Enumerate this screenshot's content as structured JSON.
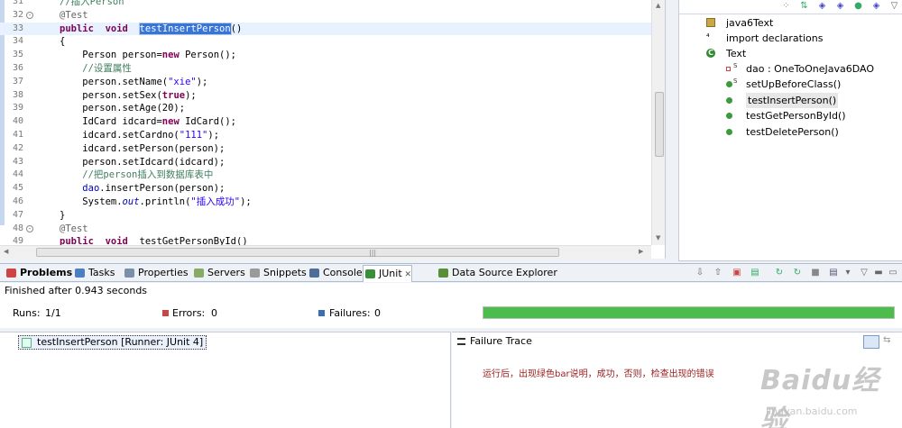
{
  "editor": {
    "lines": [
      {
        "n": "31",
        "text": "//插入Person",
        "type": "comment"
      },
      {
        "n": "32",
        "text": "@Test",
        "type": "annotation",
        "fold": true
      },
      {
        "n": "33",
        "type": "sig",
        "kw1": "public",
        "kw2": "void",
        "method": "testInsertPerson",
        "rest": "()"
      },
      {
        "n": "34",
        "text": "{",
        "type": "plain"
      },
      {
        "n": "35",
        "text": "    Person person=new Person();",
        "type": "plain"
      },
      {
        "n": "36",
        "text": "    //设置属性",
        "type": "comment"
      },
      {
        "n": "37",
        "text": "    person.setName(\"xie\");",
        "type": "plain"
      },
      {
        "n": "38",
        "text": "    person.setSex(true);",
        "type": "plain"
      },
      {
        "n": "39",
        "text": "    person.setAge(20);",
        "type": "plain"
      },
      {
        "n": "40",
        "text": "    IdCard idcard=new IdCard();",
        "type": "plain"
      },
      {
        "n": "41",
        "text": "    idcard.setCardno(\"111\");",
        "type": "plain"
      },
      {
        "n": "42",
        "text": "    idcard.setPerson(person);",
        "type": "plain"
      },
      {
        "n": "43",
        "text": "    person.setIdcard(idcard);",
        "type": "plain"
      },
      {
        "n": "44",
        "text": "    //把person插入到数据库表中",
        "type": "comment"
      },
      {
        "n": "45",
        "text": "    dao.insertPerson(person);",
        "type": "plain"
      },
      {
        "n": "46",
        "text": "    System.out.println(\"插入成功\");",
        "type": "plain"
      },
      {
        "n": "47",
        "text": "}",
        "type": "plain"
      },
      {
        "n": "48",
        "text": "@Test",
        "type": "annotation",
        "fold": true
      },
      {
        "n": "49",
        "text": "public  void  testGetPersonById()",
        "type": "plain"
      }
    ]
  },
  "outline": {
    "items": [
      {
        "label": "java6Text",
        "icon": "package-icon",
        "indent": 0
      },
      {
        "label": "import declarations",
        "icon": "import-icon",
        "indent": 0
      },
      {
        "label": "Text",
        "icon": "class-icon",
        "indent": 0
      },
      {
        "label": "dao : OneToOneJava6DAO",
        "icon": "private-field-icon",
        "indent": 1,
        "static": true
      },
      {
        "label": "setUpBeforeClass()",
        "icon": "public-method-icon",
        "indent": 1,
        "static": true
      },
      {
        "label": "testInsertPerson()",
        "icon": "public-method-icon",
        "indent": 1,
        "selected": true
      },
      {
        "label": "testGetPersonById()",
        "icon": "public-method-icon",
        "indent": 1
      },
      {
        "label": "testDeletePerson()",
        "icon": "public-method-icon",
        "indent": 1
      }
    ]
  },
  "tabs": [
    {
      "label": "Problems",
      "icon": "problems-icon",
      "color": "#c44",
      "active": false
    },
    {
      "label": "Tasks",
      "icon": "tasks-icon",
      "color": "#4a7fc1",
      "active": false
    },
    {
      "label": "Properties",
      "icon": "properties-icon",
      "color": "#7d8fa8",
      "active": false
    },
    {
      "label": "Servers",
      "icon": "servers-icon",
      "color": "#8a6",
      "active": false
    },
    {
      "label": "Snippets",
      "icon": "snippets-icon",
      "color": "#9a9a9a",
      "active": false
    },
    {
      "label": "Console",
      "icon": "console-icon",
      "color": "#4e6e9a",
      "active": false
    },
    {
      "label": "JUnit",
      "icon": "junit-icon",
      "color": "#3a8f3a",
      "active": true
    },
    {
      "label": "Data Source Explorer",
      "icon": "data-source-icon",
      "color": "#5a8f3a",
      "active": false
    }
  ],
  "junit": {
    "status": "Finished after 0.943 seconds",
    "runs_label": "Runs:",
    "runs_value": "1/1",
    "errors_label": "Errors:",
    "errors_value": "0",
    "failures_label": "Failures:",
    "failures_value": "0",
    "progress": 1.0,
    "bar_color": "#4cbd4c",
    "tree_item": "testInsertPerson [Runner: JUnit 4]",
    "trace_title": "Failure Trace",
    "note": "运行后，出现绿色bar说明，成功，否则，检查出现的错误"
  },
  "watermark": {
    "logo": "Baidu经验",
    "sub": "jingyan.baidu.com"
  }
}
